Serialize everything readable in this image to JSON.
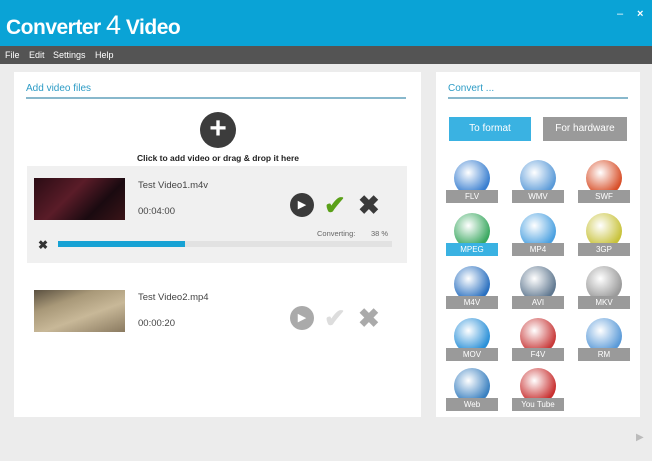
{
  "app": {
    "title_prefix": "Converter",
    "title_number": "4",
    "title_suffix": "Video",
    "minimize": "–",
    "close": "×"
  },
  "menu": [
    "File",
    "Edit",
    "Settings",
    "Help"
  ],
  "left_panel": {
    "title": "Add video files",
    "add_hint": "Click to add video or drag & drop it here",
    "add_icon": "plus-icon"
  },
  "items": [
    {
      "name": "Test Video1.m4v",
      "duration": "00:04:00",
      "status_label": "Converting:",
      "progress_text": "38 %",
      "progress": 38,
      "active": true
    },
    {
      "name": "Test Video2.mp4",
      "duration": "00:00:20",
      "active": false
    }
  ],
  "right_panel": {
    "title": "Convert ...",
    "to_format": "To format",
    "for_hardware": "For hardware",
    "formats": [
      {
        "label": "FLV",
        "color": "#3a7fd0"
      },
      {
        "label": "WMV",
        "color": "#5a9ad8"
      },
      {
        "label": "SWF",
        "color": "#d8502a"
      },
      {
        "label": "MPEG",
        "color": "#3aa860",
        "selected": true
      },
      {
        "label": "MP4",
        "color": "#4aa0e0"
      },
      {
        "label": "3GP",
        "color": "#c8c23a"
      },
      {
        "label": "M4V",
        "color": "#2a70c0"
      },
      {
        "label": "AVI",
        "color": "#607890"
      },
      {
        "label": "MKV",
        "color": "#9a9a9a"
      },
      {
        "label": "MOV",
        "color": "#2a90d8"
      },
      {
        "label": "F4V",
        "color": "#c83a3a"
      },
      {
        "label": "RM",
        "color": "#5a9ad8"
      },
      {
        "label": "Web",
        "color": "#3a80c0"
      },
      {
        "label": "You Tube",
        "color": "#c83030"
      }
    ]
  },
  "colors": {
    "accent": "#0aa3d6",
    "menubar": "#545454",
    "progress": "#17a2d4",
    "check": "#5aa018"
  }
}
